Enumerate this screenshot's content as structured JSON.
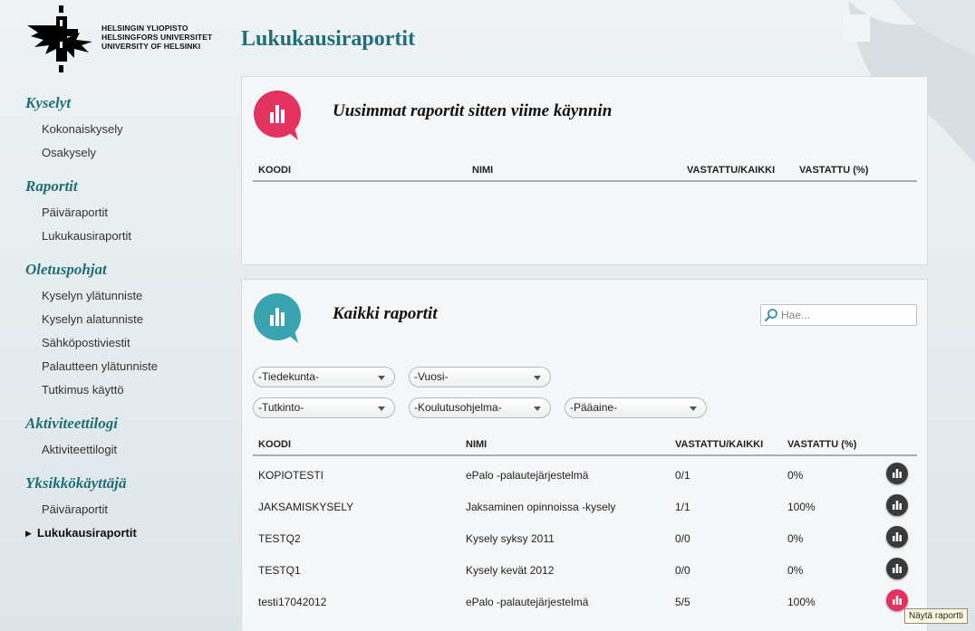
{
  "logo": {
    "line1": "HELSINGIN YLIOPISTO",
    "line2": "HELSINGFORS UNIVERSITET",
    "line3": "UNIVERSITY OF HELSINKI"
  },
  "sidebar": {
    "groups": [
      {
        "heading": "Kyselyt",
        "items": [
          "Kokonaiskysely",
          "Osakysely"
        ]
      },
      {
        "heading": "Raportit",
        "items": [
          "Päiväraportit",
          "Lukukausiraportit"
        ]
      },
      {
        "heading": "Oletuspohjat",
        "items": [
          "Kyselyn ylätunniste",
          "Kyselyn alatunniste",
          "Sähköpostiviestit",
          "Palautteen ylätunniste",
          "Tutkimus käyttö"
        ]
      },
      {
        "heading": "Aktiviteettilogi",
        "items": [
          "Aktiviteettilogit"
        ]
      },
      {
        "heading": "Yksikkökäyttäjä",
        "items": [
          "Päiväraportit",
          "Lukukausiraportit"
        ]
      }
    ],
    "active_arrow": "▶"
  },
  "page_title": "Lukukausiraportit",
  "recent_panel": {
    "title": "Uusimmat raportit sitten viime käynnin",
    "columns": [
      "KOODI",
      "NIMI",
      "VASTATTU/KAIKKI",
      "VASTATTU (%)"
    ],
    "icon_color": "#e3325f"
  },
  "all_panel": {
    "title": "Kaikki raportit",
    "icon_color": "#3aa3b0",
    "search_placeholder": "Hae...",
    "filters": {
      "tiedekunta": "-Tiedekunta-",
      "vuosi": "-Vuosi-",
      "tutkinto": "-Tutkinto-",
      "koulutusohjelma": "-Koulutusohjelma-",
      "paaaine": "-Pääaine-"
    },
    "columns": [
      "KOODI",
      "NIMI",
      "VASTATTU/KAIKKI",
      "VASTATTU (%)"
    ],
    "rows": [
      {
        "code": "KOPIOTESTI",
        "name": "ePalo -palautejärjestelmä",
        "answered": "0/1",
        "percent": "0%"
      },
      {
        "code": "JAKSAMISKYSELY",
        "name": "Jaksaminen opinnoissa -kysely",
        "answered": "1/1",
        "percent": "100%"
      },
      {
        "code": "TESTQ2",
        "name": "Kysely syksy 2011",
        "answered": "0/0",
        "percent": "0%"
      },
      {
        "code": "TESTQ1",
        "name": "Kysely kevät 2012",
        "answered": "0/0",
        "percent": "0%"
      },
      {
        "code": "testi17042012",
        "name": "ePalo -palautejärjestelmä",
        "answered": "5/5",
        "percent": "100%"
      }
    ]
  },
  "tooltip": "Näytä raportti"
}
